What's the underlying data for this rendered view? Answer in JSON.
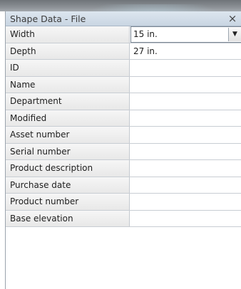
{
  "panel": {
    "title": "Shape Data - File",
    "close_glyph": "×",
    "close_icon": "close-icon"
  },
  "rows": [
    {
      "label": "Width",
      "value": "15 in.",
      "has_dropdown": true,
      "selected": true
    },
    {
      "label": "Depth",
      "value": "27 in."
    },
    {
      "label": "ID",
      "value": ""
    },
    {
      "label": "Name",
      "value": ""
    },
    {
      "label": "Department",
      "value": ""
    },
    {
      "label": "Modified",
      "value": ""
    },
    {
      "label": "Asset number",
      "value": ""
    },
    {
      "label": "Serial number",
      "value": ""
    },
    {
      "label": "Product description",
      "value": ""
    },
    {
      "label": "Purchase date",
      "value": ""
    },
    {
      "label": "Product number",
      "value": ""
    },
    {
      "label": "Base elevation",
      "value": ""
    }
  ],
  "dropdown_glyph": "▼",
  "dropdown_icon": "chevron-down-icon"
}
